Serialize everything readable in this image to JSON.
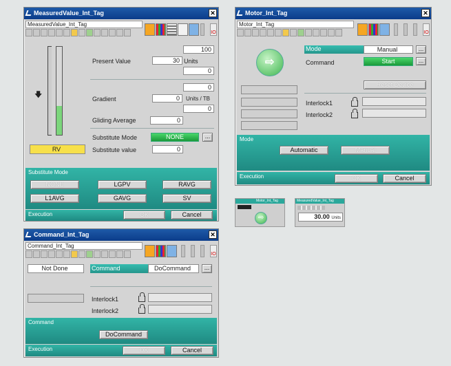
{
  "mv": {
    "title": "MeasuredValue_Int_Tag",
    "tag": "MeasuredValue_Int_Tag",
    "close": "✕",
    "present_label": "Present Value",
    "present_value": "30",
    "present_unit": "Units",
    "top_value": "100",
    "under_present": "0",
    "upper_grad": "0",
    "gradient_label": "Gradient",
    "gradient_value": "0",
    "gradient_unit": "Units / TB",
    "under_grad": "0",
    "gliding_label": "Gliding Average",
    "gliding_value": "0",
    "subst_mode_label": "Substitute Mode",
    "subst_mode_value": "NONE",
    "subst_value_label": "Substitute value",
    "subst_value": "0",
    "rv_label": "RV",
    "subst_section": "Substitute Mode",
    "btns": [
      "NONE",
      "LGPV",
      "RAVG",
      "L1AVG",
      "GAVG",
      "SV"
    ],
    "exec_label": "Execution",
    "ok": "OK",
    "cancel": "Cancel",
    "more": "..."
  },
  "motor": {
    "title": "Motor_Int_Tag",
    "tag": "Motor_Int_Tag",
    "close": "✕",
    "mode_label": "Mode",
    "mode_value": "Manual",
    "command_label": "Command",
    "command_value": "Start",
    "reset_label": "Reset Device",
    "interlock1": "Interlock1",
    "interlock2": "Interlock2",
    "mode_section": "Mode",
    "automatic": "Automatic",
    "manual": "Manual",
    "exec_label": "Execution",
    "ok": "OK",
    "cancel": "Cancel",
    "more": "..."
  },
  "mini_motor": {
    "title": "Motor_Int_Tag"
  },
  "mini_mv": {
    "title": "MeasuredValue_Int_Tag",
    "value": "30.00",
    "unit": "Units"
  },
  "cmd": {
    "title": "Command_Int_Tag",
    "tag": "Command_Int_Tag",
    "close": "✕",
    "status": "Not Done",
    "command_label": "Command",
    "command_value": "DoCommand",
    "interlock1": "Interlock1",
    "interlock2": "Interlock2",
    "cmd_section": "Command",
    "docommand": "DoCommand",
    "exec_label": "Execution",
    "ok": "OK",
    "cancel": "Cancel",
    "more": "..."
  },
  "colors": {
    "title": "#1e5aa8",
    "teal": "#2aa89b",
    "green": "#2fbf4d",
    "yellow": "#f7e04a"
  }
}
